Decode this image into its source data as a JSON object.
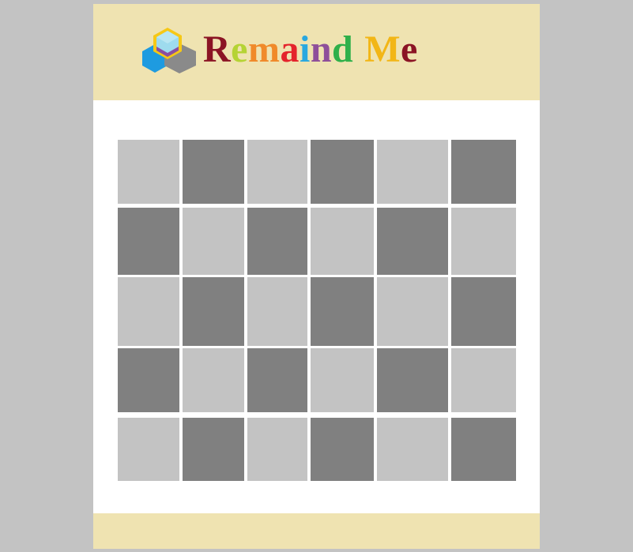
{
  "app": {
    "title_letters": [
      {
        "char": "R",
        "color": "#8b1424"
      },
      {
        "char": "e",
        "color": "#b5d334"
      },
      {
        "char": "m",
        "color": "#f08a2a"
      },
      {
        "char": "a",
        "color": "#e4242c"
      },
      {
        "char": "i",
        "color": "#29a8e0"
      },
      {
        "char": "n",
        "color": "#8e4f9a"
      },
      {
        "char": "d",
        "color": "#2fb04a"
      },
      {
        "char": "M",
        "color": "#f2b616"
      },
      {
        "char": "e",
        "color": "#8b1424"
      }
    ],
    "logo": {
      "icon": "stacked-cubes-icon",
      "colors": {
        "top": "#f6c816",
        "top_inner": "#9edbee",
        "purple": "#8a4fa1",
        "left": "#1e9be0",
        "right": "#8a8a8a"
      }
    }
  },
  "colors": {
    "page_background": "#c3c3c3",
    "header_background": "#efe3b1",
    "board_background": "#ffffff",
    "tile_light": "#c3c3c3",
    "tile_dark": "#808080"
  },
  "board": {
    "rows": 5,
    "columns": 6,
    "tiles": [
      [
        "light",
        "dark",
        "light",
        "dark",
        "light",
        "dark"
      ],
      [
        "dark",
        "light",
        "dark",
        "light",
        "dark",
        "light"
      ],
      [
        "light",
        "dark",
        "light",
        "dark",
        "light",
        "dark"
      ],
      [
        "dark",
        "light",
        "dark",
        "light",
        "dark",
        "light"
      ],
      [
        "light",
        "dark",
        "light",
        "dark",
        "light",
        "dark"
      ]
    ]
  }
}
